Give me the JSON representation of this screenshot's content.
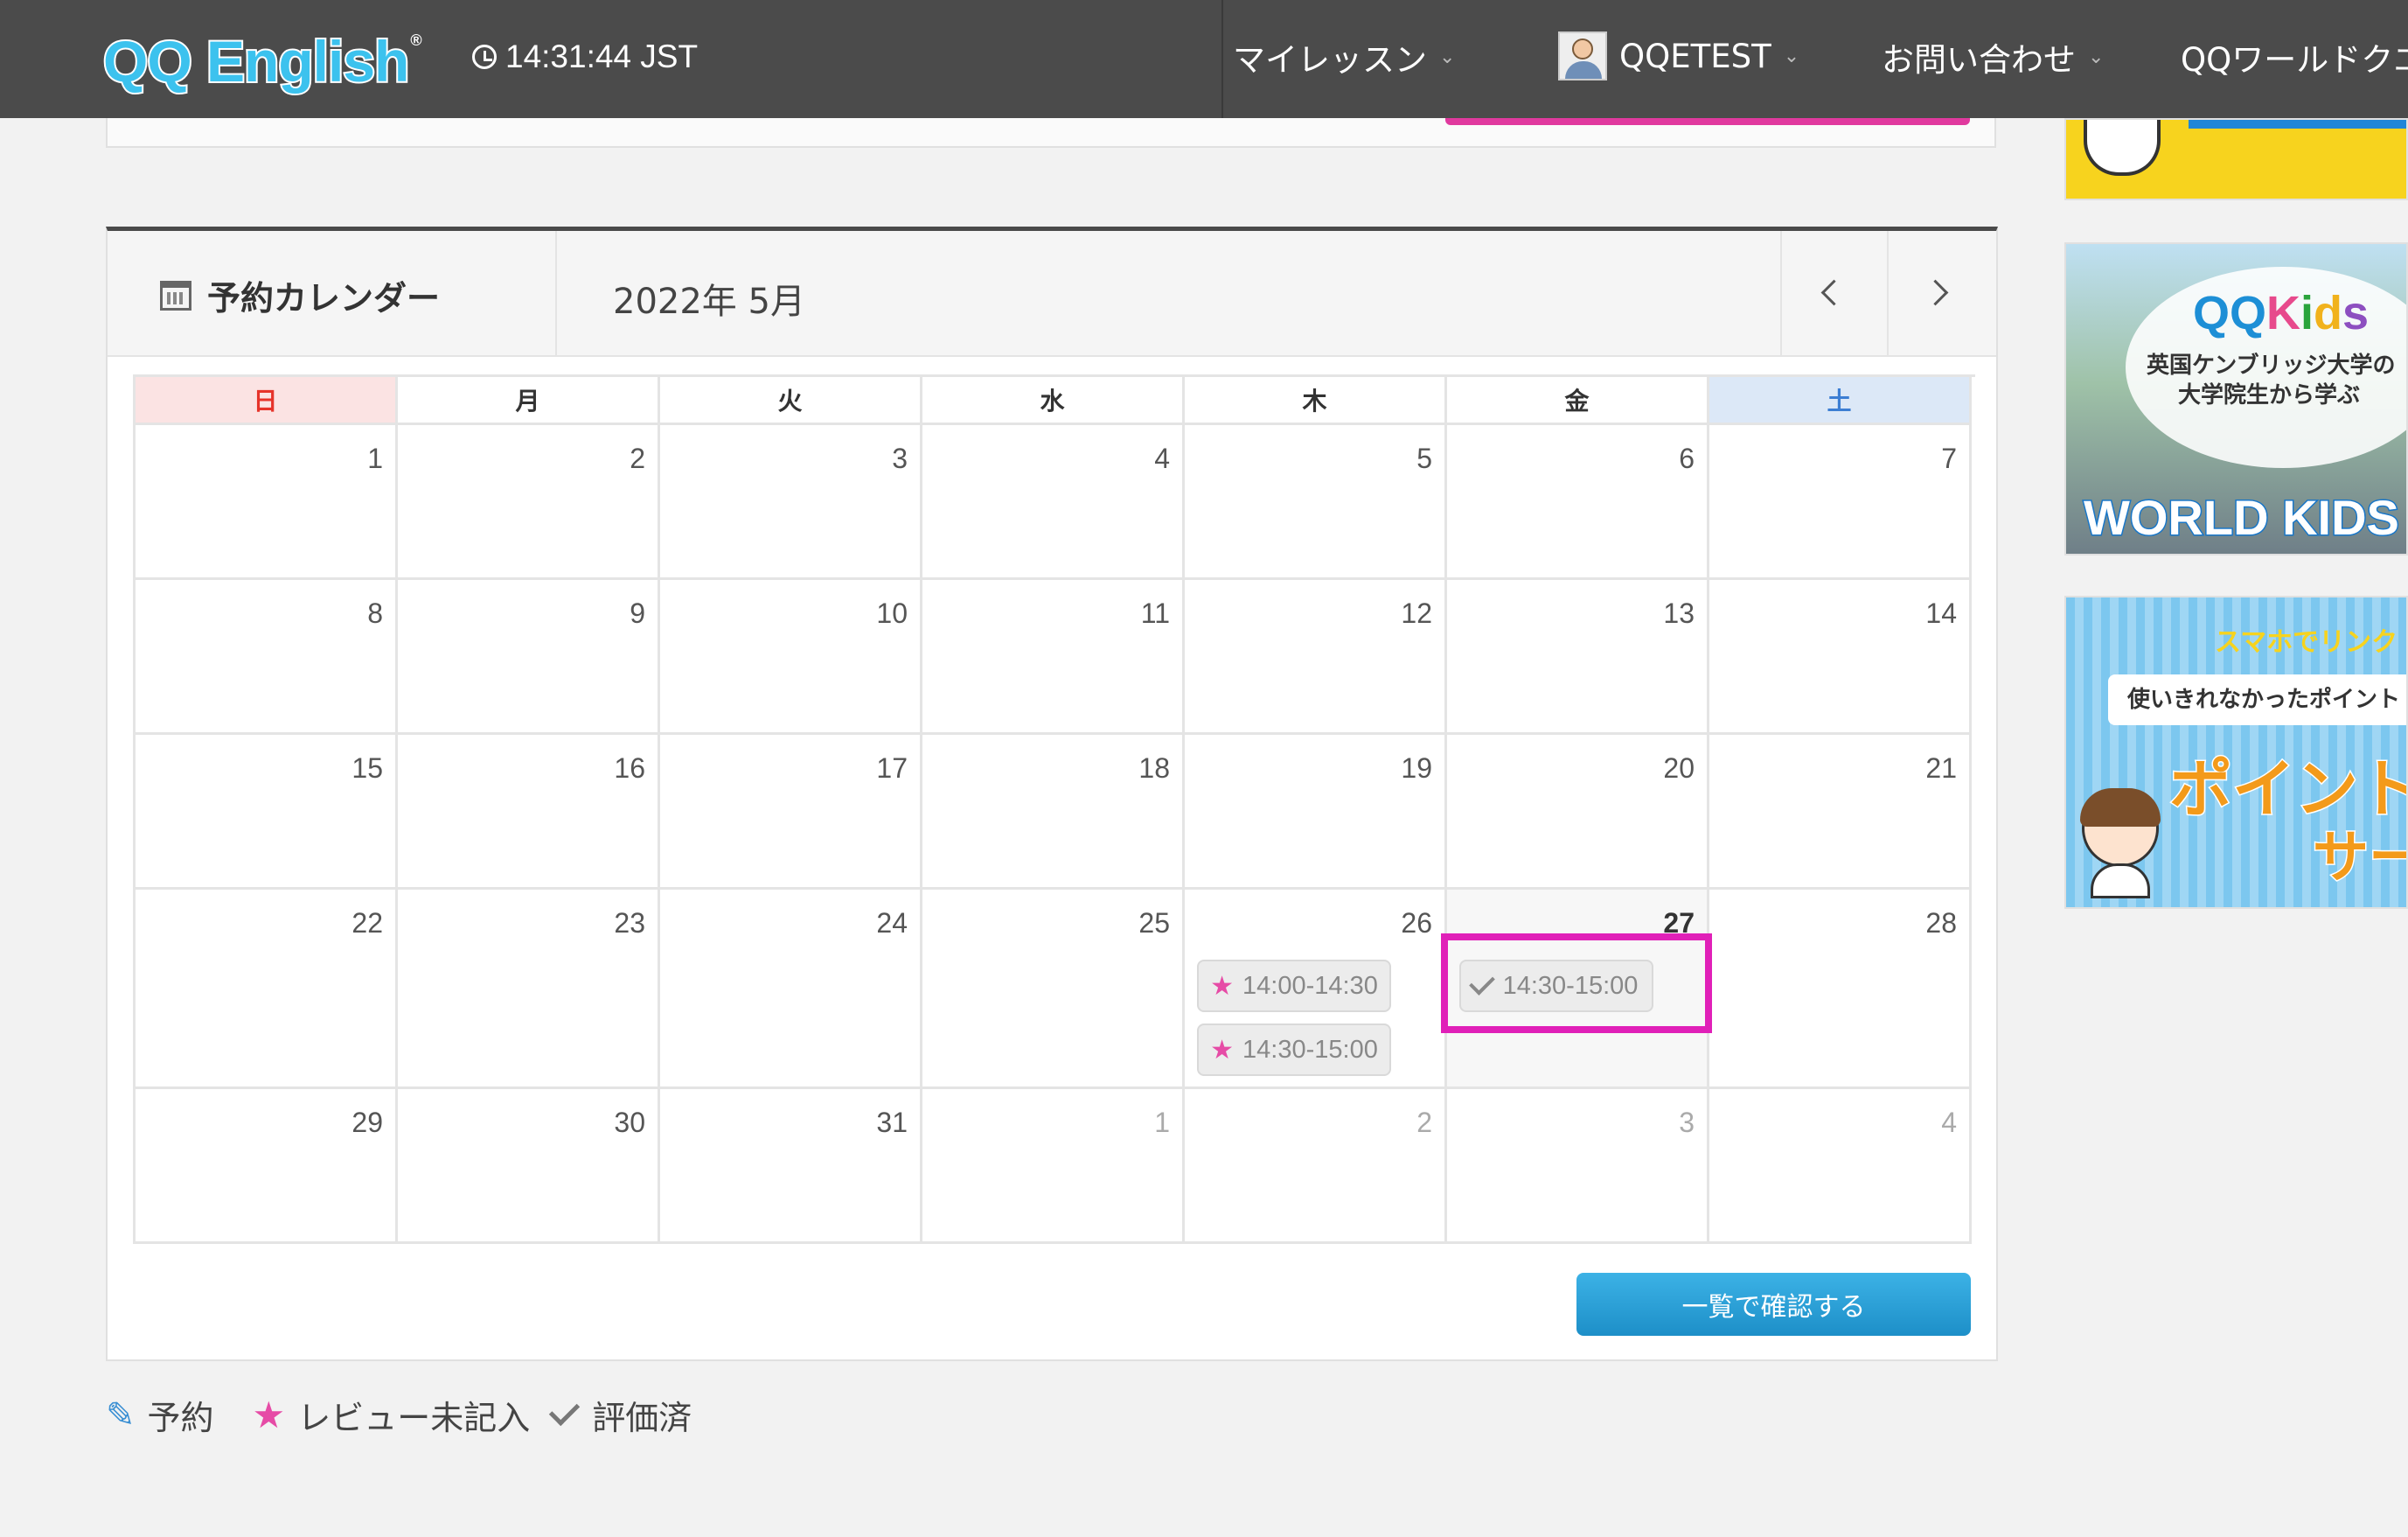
{
  "header": {
    "logo": "QQ English",
    "logo_mark": "®",
    "clock": "14:31:44 JST",
    "nav": [
      {
        "label": "マイレッスン"
      },
      {
        "label": "QQETEST"
      },
      {
        "label": "お問い合わせ"
      },
      {
        "label": "QQワールドクエ"
      }
    ],
    "chevron": "⌄"
  },
  "calendar": {
    "title": "予約カレンダー",
    "month": "2022年 5月",
    "weekdays": [
      "日",
      "月",
      "火",
      "水",
      "木",
      "金",
      "土"
    ],
    "weeks": [
      [
        "1",
        "2",
        "3",
        "4",
        "5",
        "6",
        "7"
      ],
      [
        "8",
        "9",
        "10",
        "11",
        "12",
        "13",
        "14"
      ],
      [
        "15",
        "16",
        "17",
        "18",
        "19",
        "20",
        "21"
      ],
      [
        "22",
        "23",
        "24",
        "25",
        "26",
        "27",
        "28"
      ],
      [
        "29",
        "30",
        "31",
        "1",
        "2",
        "3",
        "4"
      ]
    ],
    "events": {
      "thu26": [
        {
          "icon": "star-icon",
          "time": "14:00-14:30"
        },
        {
          "icon": "star-icon",
          "time": "14:30-15:00"
        }
      ],
      "fri27": [
        {
          "icon": "check-icon",
          "time": "14:30-15:00"
        }
      ]
    },
    "list_button": "一覧で確認する"
  },
  "legend": {
    "reserve": "予約",
    "review_pending": "レビュー未記入",
    "rated": "評価済"
  },
  "banners": {
    "kids": {
      "brand_q": "QQ",
      "brand_k": "K",
      "brand_i": "i",
      "brand_d": "d",
      "brand_s": "s",
      "line1": "英国ケンブリッジ大学の",
      "line2": "大学院生から学ぶ",
      "bottom": "WORLD KIDS C"
    },
    "points": {
      "line1": "スマホでリンク",
      "line2": "使いきれなかったポイント",
      "line3": "ポイント",
      "line4": "サー"
    }
  },
  "colors": {
    "header_bg": "#4b4b4b",
    "sunday": "#e6332a",
    "saturday": "#3c7ed3",
    "review_star": "#e64ba6",
    "highlight": "#e020b8",
    "button": "#1d8fc8"
  }
}
